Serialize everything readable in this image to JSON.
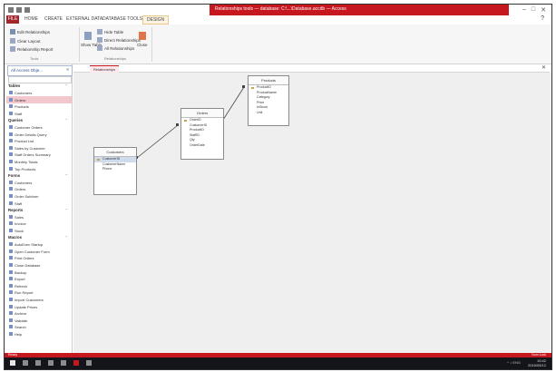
{
  "window": {
    "title": "Relationships tools — database: C:\\...\\Database.accdb — Access",
    "controls": [
      "–",
      "□",
      "✕"
    ]
  },
  "ribbon": {
    "file_tab": "FILE",
    "tabs": [
      "HOME",
      "CREATE",
      "EXTERNAL DATA",
      "DATABASE TOOLS"
    ],
    "active_tab": "DESIGN",
    "help": "?",
    "buttons": {
      "edit_relationships": "Edit Relationships",
      "clear_layout": "Clear Layout",
      "relationship_report": "Relationship Report",
      "show_table": "Show Table",
      "hide_table": "Hide Table",
      "direct_relationships": "Direct Relationships",
      "all_relationships": "All Relationships",
      "close": "Close"
    },
    "groups": {
      "tools": "Tools",
      "relationships": "Relationships"
    }
  },
  "nav": {
    "title": "All Access Obje...",
    "collapse": "«",
    "search_placeholder": "Search...",
    "rows": [
      {
        "type": "group",
        "label": "Tables"
      },
      {
        "type": "item",
        "label": "Customers"
      },
      {
        "type": "item",
        "label": "Orders",
        "selected": true
      },
      {
        "type": "item",
        "label": "Products"
      },
      {
        "type": "item",
        "label": "Staff"
      },
      {
        "type": "group",
        "label": "Queries"
      },
      {
        "type": "item",
        "label": "Customer Orders"
      },
      {
        "type": "item",
        "label": "Order Details Query"
      },
      {
        "type": "item",
        "label": "Product List"
      },
      {
        "type": "item",
        "label": "Sales by Customer"
      },
      {
        "type": "item",
        "label": "Staff Orders Summary"
      },
      {
        "type": "item",
        "label": "Monthly Totals"
      },
      {
        "type": "item",
        "label": "Top Products"
      },
      {
        "type": "group",
        "label": "Forms"
      },
      {
        "type": "item",
        "label": "Customers"
      },
      {
        "type": "item",
        "label": "Orders"
      },
      {
        "type": "item",
        "label": "Order Subform"
      },
      {
        "type": "item",
        "label": "Staff"
      },
      {
        "type": "group",
        "label": "Reports"
      },
      {
        "type": "item",
        "label": "Sales"
      },
      {
        "type": "item",
        "label": "Invoice"
      },
      {
        "type": "item",
        "label": "Stock"
      },
      {
        "type": "group",
        "label": "Macros"
      },
      {
        "type": "item",
        "label": "AutoExec Startup"
      },
      {
        "type": "item",
        "label": "Open Customer Form"
      },
      {
        "type": "item",
        "label": "Print Orders"
      },
      {
        "type": "item",
        "label": "Close Database"
      },
      {
        "type": "item",
        "label": "Backup"
      },
      {
        "type": "item",
        "label": "Export"
      },
      {
        "type": "item",
        "label": "Refresh"
      },
      {
        "type": "item",
        "label": "Run Report"
      },
      {
        "type": "item",
        "label": "Import Customers"
      },
      {
        "type": "item",
        "label": "Update Prices"
      },
      {
        "type": "item",
        "label": "Archive"
      },
      {
        "type": "item",
        "label": "Validate"
      },
      {
        "type": "item",
        "label": "Search"
      },
      {
        "type": "item",
        "label": "Help"
      }
    ]
  },
  "document_tab": {
    "label": "Relationships",
    "close": "✕"
  },
  "tables": [
    {
      "name": "Customers",
      "fields": [
        {
          "label": "CustomerID",
          "key": true,
          "highlight": true
        },
        {
          "label": "CustomerName"
        },
        {
          "label": "Phone"
        }
      ]
    },
    {
      "name": "Orders",
      "fields": [
        {
          "label": "OrderID",
          "key": true
        },
        {
          "label": "CustomerID"
        },
        {
          "label": "ProductID"
        },
        {
          "label": "StaffID"
        },
        {
          "label": "Qty"
        },
        {
          "label": "OrderDate"
        }
      ]
    },
    {
      "name": "Products",
      "fields": [
        {
          "label": "ProductID",
          "key": true
        },
        {
          "label": "ProductName"
        },
        {
          "label": "Category"
        },
        {
          "label": "Price"
        },
        {
          "label": "InStock"
        },
        {
          "label": "Unit"
        }
      ]
    }
  ],
  "status": {
    "left": "Ready",
    "right": "Num Lock"
  },
  "taskbar": {
    "time": "10:42",
    "date": "2016/05/12",
    "tray": "^ ♪ ENG"
  }
}
